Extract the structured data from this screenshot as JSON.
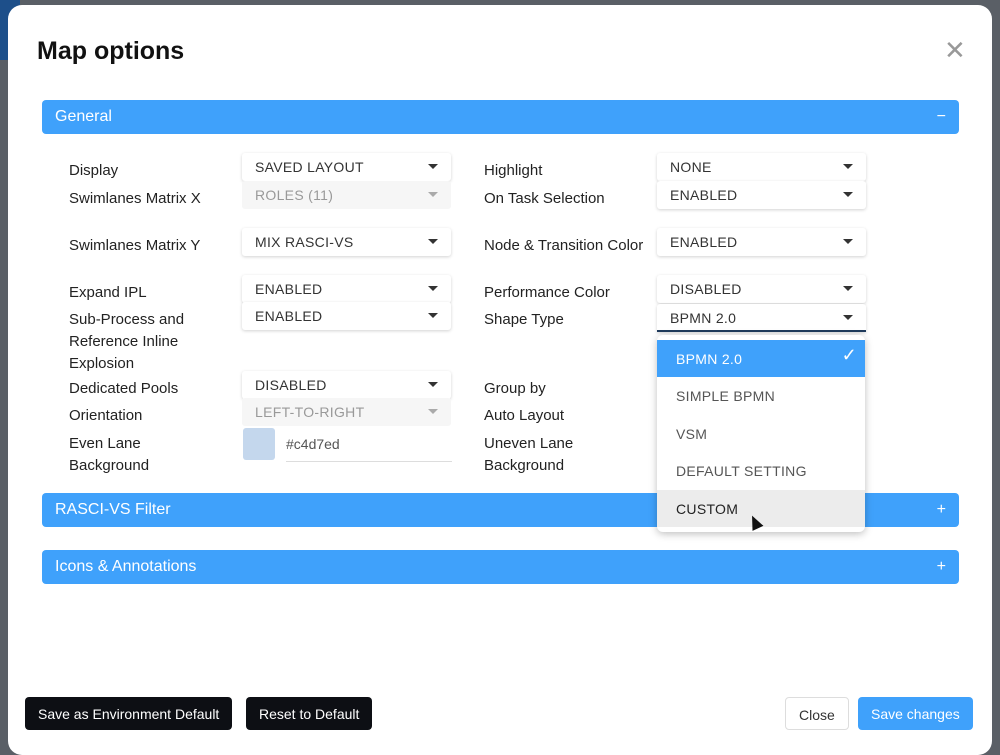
{
  "modal": {
    "title": "Map options",
    "close_icon": "close-icon"
  },
  "sections": {
    "general": {
      "label": "General",
      "toggle": "−"
    },
    "rasci": {
      "label": "RASCI-VS Filter",
      "toggle": "+"
    },
    "icons": {
      "label": "Icons & Annotations",
      "toggle": "+"
    }
  },
  "left": [
    {
      "label": "Display",
      "value": "SAVED LAYOUT",
      "disabled": false
    },
    {
      "label": "Swimlanes Matrix X",
      "value": "ROLES (11)",
      "disabled": true
    },
    {
      "label": "Swimlanes Matrix Y",
      "value": "MIX RASCI-VS",
      "disabled": false
    },
    {
      "label": "Expand IPL",
      "value": "ENABLED",
      "disabled": false
    },
    {
      "label": "Sub-Process and Reference Inline Explosion",
      "value": "ENABLED",
      "disabled": false
    },
    {
      "label": "Dedicated Pools",
      "value": "DISABLED",
      "disabled": false
    },
    {
      "label": "Orientation",
      "value": "LEFT-TO-RIGHT",
      "disabled": true
    },
    {
      "label": "Even Lane Background",
      "value": "#c4d7ed"
    }
  ],
  "right": [
    {
      "label": "Highlight",
      "value": "NONE"
    },
    {
      "label": "On Task Selection",
      "value": "ENABLED"
    },
    {
      "label": "Node & Transition Color",
      "value": "ENABLED"
    },
    {
      "label": "Performance Color",
      "value": "DISABLED"
    },
    {
      "label": "Shape Type",
      "value": "BPMN 2.0"
    },
    {
      "label": "Group by"
    },
    {
      "label": "Auto Layout"
    },
    {
      "label": "Uneven Lane Background"
    }
  ],
  "dropdown": {
    "options": [
      "BPMN 2.0",
      "SIMPLE BPMN",
      "VSM",
      "DEFAULT SETTING",
      "CUSTOM"
    ],
    "selected": "BPMN 2.0",
    "hovered": "CUSTOM"
  },
  "footer": {
    "save_env": "Save as Environment Default",
    "reset": "Reset to Default",
    "close": "Close",
    "save": "Save changes"
  },
  "colors": {
    "accent": "#3fa1fb",
    "even_lane": "#c4d7ed"
  }
}
